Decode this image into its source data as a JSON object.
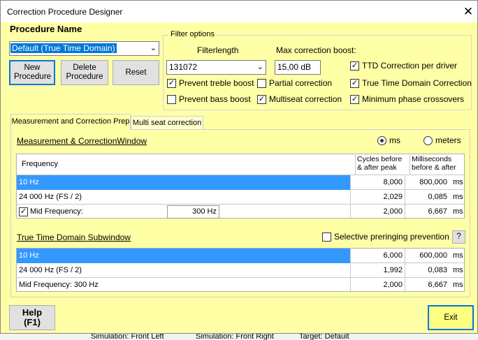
{
  "window": {
    "title": "Correction Procedure Designer",
    "close_glyph": "✕"
  },
  "procedure": {
    "heading": "Procedure Name",
    "selected": "Default (True Time Domain)",
    "buttons": {
      "new": "New Procedure",
      "delete": "Delete Procedure",
      "reset": "Reset"
    }
  },
  "filter_options": {
    "legend": "Filter options",
    "filterlength_label": "Filterlength",
    "filterlength_value": "131072",
    "max_boost_label": "Max correction boost:",
    "max_boost_value": "15,00 dB",
    "checkboxes": {
      "prevent_treble": {
        "label": "Prevent treble boost",
        "checked": true
      },
      "partial_correction": {
        "label": "Partial correction",
        "checked": false
      },
      "ttd_per_driver": {
        "label": "TTD Correction per driver",
        "checked": true
      },
      "prevent_bass": {
        "label": "Prevent bass boost",
        "checked": false
      },
      "multiseat": {
        "label": "Multiseat correction",
        "checked": true
      },
      "ttd_correction": {
        "label": "True Time Domain Correction",
        "checked": true
      },
      "min_phase": {
        "label": "Minimum phase crossovers",
        "checked": true
      }
    }
  },
  "tabs": [
    "Measurement and Correction Prep",
    "Multi seat correction"
  ],
  "measurement": {
    "title": "Measurement & CorrectionWindow",
    "units": {
      "ms": "ms",
      "meters": "meters",
      "selected": "ms"
    },
    "headers": {
      "frequency": "Frequency",
      "cycles": "Cycles before\n& after peak",
      "ms": "Milliseconds\nbefore & after"
    },
    "rows": [
      {
        "freq": "10 Hz",
        "cycles": "8,000",
        "ms": "800,000",
        "unit": "ms",
        "selected": true
      },
      {
        "freq": "24 000 Hz (FS / 2)",
        "cycles": "2,029",
        "ms": "0,085",
        "unit": "ms"
      },
      {
        "freq": "Mid Frequency:",
        "mid_value": "300 Hz",
        "cycles": "2,000",
        "ms": "6,667",
        "unit": "ms",
        "checked": true
      }
    ]
  },
  "ttd": {
    "title": "True Time Domain Subwindow",
    "preringing_label": "Selective preringing prevention",
    "help_glyph": "?",
    "rows": [
      {
        "freq": "10 Hz",
        "cycles": "6,000",
        "ms": "600,000",
        "unit": "ms",
        "selected": true
      },
      {
        "freq": "24 000 Hz (FS / 2)",
        "cycles": "1,992",
        "ms": "0,083",
        "unit": "ms"
      },
      {
        "freq": "Mid Frequency: 300 Hz",
        "cycles": "2,000",
        "ms": "6,667",
        "unit": "ms"
      }
    ]
  },
  "footer": {
    "help": "Help\n(F1)",
    "exit": "Exit"
  },
  "background_strip": [
    "Simulation: Front Left",
    "Simulation: Front Right",
    "Target: Default"
  ],
  "colors": {
    "window_bg": "#ffffa6",
    "selected_row": "#3399ff",
    "exit_bg": "#ffff80"
  }
}
